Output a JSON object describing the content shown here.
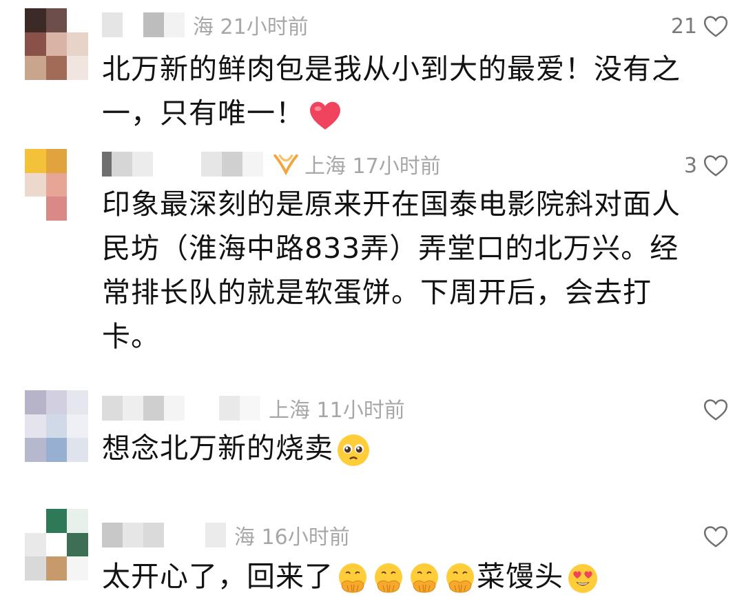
{
  "comments": [
    {
      "meta": "海 21小时前",
      "likes": "21",
      "lines": [
        "北万新的鲜肉包是我从小到大的最爱！没有之",
        "一，只有唯一！"
      ],
      "trailing_emoji": "heart"
    },
    {
      "meta": "上海 17小时前",
      "badge": "fan-badge-icon",
      "likes": "3",
      "lines": [
        "印象最深刻的是原来开在国泰电影院斜对面人",
        "民坊（淮海中路833弄）弄堂口的北万兴。经",
        "常排长队的就是软蛋饼。下周开后，会去打",
        "卡。"
      ]
    },
    {
      "meta": "上海 11小时前",
      "likes": "",
      "lines": [
        "想念北万新的烧卖"
      ],
      "trailing_emoji": "pleading-face"
    },
    {
      "meta": "海 16小时前",
      "likes": "",
      "lines": [
        "太开心了，回来了",
        "菜馒头"
      ],
      "emojis": [
        "hands-over-mouth",
        "hands-over-mouth",
        "hands-over-mouth",
        "hands-over-mouth",
        "heart-eyes"
      ]
    }
  ],
  "colors": {
    "meta_gray": "#a7a7a7",
    "heart_red": "#f0445e",
    "emoji_yellow": "#ffcc3a"
  }
}
